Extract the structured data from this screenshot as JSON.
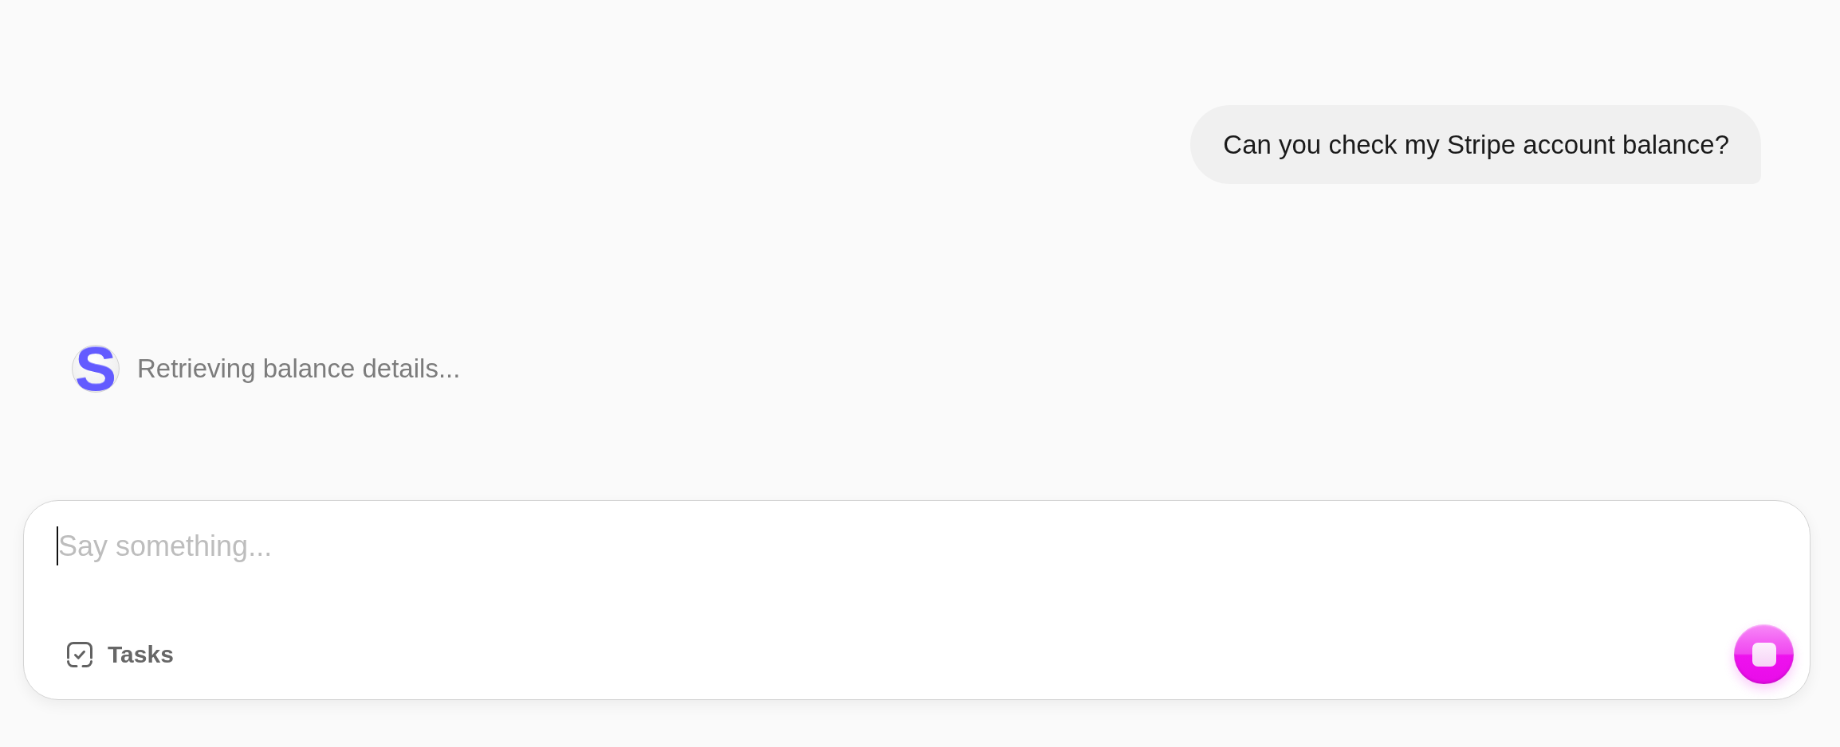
{
  "messages": [
    {
      "kind": "user",
      "text": "Can you check my Stripe account balance?"
    },
    {
      "kind": "status",
      "avatar": "S",
      "text": "Retrieving balance details..."
    }
  ],
  "composer": {
    "input": {
      "placeholder": "Say something...",
      "focused": true
    },
    "tasks_button": {
      "label": "Tasks"
    },
    "busy": true
  }
}
